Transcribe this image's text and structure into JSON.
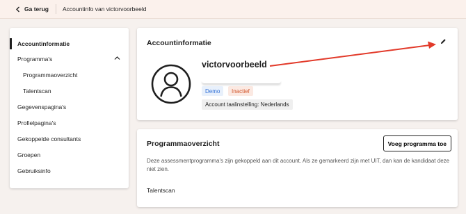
{
  "topbar": {
    "back_label": "Ga terug",
    "title": "Accountinfo van victorvoorbeeld"
  },
  "sidebar": {
    "items": [
      {
        "label": "Accountinformatie",
        "active": true
      },
      {
        "label": "Programma's",
        "expanded": true
      },
      {
        "label": "Programmaoverzicht",
        "indent": true
      },
      {
        "label": "Talentscan",
        "indent": true
      },
      {
        "label": "Gegevenspagina's"
      },
      {
        "label": "Profielpagina's"
      },
      {
        "label": "Gekoppelde consultants"
      },
      {
        "label": "Groepen"
      },
      {
        "label": "Gebruiksinfo"
      }
    ]
  },
  "account": {
    "title": "Accountinformatie",
    "username": "victorvoorbeeld",
    "badges": {
      "demo": "Demo",
      "inactief": "Inactief"
    },
    "language": "Account taalinstelling: Nederlands"
  },
  "programs": {
    "title": "Programmaoverzicht",
    "add_button": "Voeg programma toe",
    "description": "Deze assessmentprogramma's zijn gekoppeld aan dit account. Als ze gemarkeerd zijn met UIT, dan kan de kandidaat deze niet zien.",
    "items": [
      "Talentscan"
    ]
  },
  "colors": {
    "background": "#f6f1ee",
    "topbar": "#fbf1ec",
    "badge_demo": "#2f6fd6",
    "badge_inactief": "#d2562c",
    "annotation_arrow": "#e23a2a"
  }
}
